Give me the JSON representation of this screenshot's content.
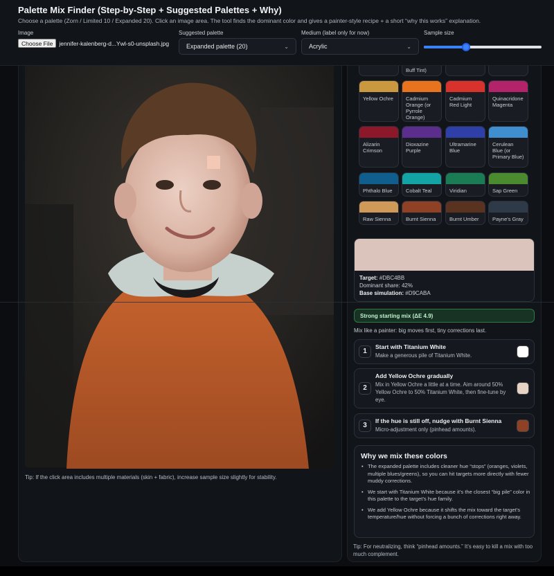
{
  "app": {
    "title": "Palette Mix Finder (Step-by-Step + Suggested Palettes + Why)",
    "subtitle": "Choose a palette (Zorn / Limited 10 / Expanded 20). Click an image area. The tool finds the dominant color and gives a painter-style recipe + a short “why this works” explanation."
  },
  "controls": {
    "image_label": "Image",
    "choose_file": "Choose File",
    "file_name": "jennifer-kalenberg-d...Ywl-s0-unsplash.jpg",
    "palette_label": "Suggested palette",
    "palette_value": "Expanded palette (20)",
    "medium_label": "Medium (label only for now)",
    "medium_value": "Acrylic",
    "sample_label": "Sample size",
    "sample_fraction": 0.36
  },
  "image_tip": "Tip: If the click area includes multiple materials (skin + fabric), increase sample size slightly for stability.",
  "palette": {
    "partial_label": "Buff Tint)",
    "swatches": [
      {
        "name": "Yellow Ochre",
        "color": "#C9983F"
      },
      {
        "name": "Cadmium Orange (or Pyrrole Orange)",
        "color": "#E7731F"
      },
      {
        "name": "Cadmium Red Light",
        "color": "#D8322C"
      },
      {
        "name": "Quinacridone Magenta",
        "color": "#B2236A"
      },
      {
        "name": "Alizarin Crimson",
        "color": "#8D1829"
      },
      {
        "name": "Dioxazine Purple",
        "color": "#5B2D8C"
      },
      {
        "name": "Ultramarine Blue",
        "color": "#2E3FA8"
      },
      {
        "name": "Cerulean Blue (or Primary Blue)",
        "color": "#3F8FD0"
      },
      {
        "name": "Phthalo Blue",
        "color": "#0F5E8E"
      },
      {
        "name": "Cobalt Teal",
        "color": "#14A3A5"
      },
      {
        "name": "Viridian",
        "color": "#1A7B55"
      },
      {
        "name": "Sap Green",
        "color": "#4C8A2F"
      },
      {
        "name": "Raw Sienna",
        "color": "#CF9A57"
      },
      {
        "name": "Burnt Sienna",
        "color": "#8E4124"
      },
      {
        "name": "Burnt Umber",
        "color": "#5A3220"
      },
      {
        "name": "Payne's Gray",
        "color": "#2E3A48"
      }
    ]
  },
  "target": {
    "color": "#DBC4BB",
    "target_label": "Target:",
    "target_value": "#DBC4BB",
    "share_label": "Dominant share:",
    "share_value": "42%",
    "base_label": "Base simulation:",
    "base_value": "#D9CABA"
  },
  "mix": {
    "badge": "Strong starting mix (ΔE 4.9)",
    "painter_line": "Mix like a painter: big moves first, tiny corrections last.",
    "steps": [
      {
        "num": "1",
        "title": "Start with Titanium White",
        "desc": "Make a generous pile of Titanium White.",
        "color": "#FFFFFF"
      },
      {
        "num": "2",
        "title": "Add Yellow Ochre gradually",
        "desc": "Mix in Yellow Ochre a little at a time. Aim around 50% Yellow Ochre to 50% Titanium White, then fine-tune by eye.",
        "color": "#E5D3C6"
      },
      {
        "num": "3",
        "title": "If the hue is still off, nudge with Burnt Sienna",
        "desc": "Micro-adjustment only (pinhead amounts).",
        "color": "#8E4124"
      }
    ]
  },
  "why": {
    "title": "Why we mix these colors",
    "items": [
      "The expanded palette includes cleaner hue “stops” (oranges, violets, multiple blues/greens), so you can hit targets more directly with fewer muddy corrections.",
      "We start with Titanium White because it’s the closest “big pile” color in this palette to the target’s hue family.",
      "We add Yellow Ochre because it shifts the mix toward the target’s temperature/hue without forcing a bunch of corrections right away."
    ]
  },
  "bottom_tip": "Tip: For neutralizing, think “pinhead amounts.” It’s easy to kill a mix with too much complement."
}
